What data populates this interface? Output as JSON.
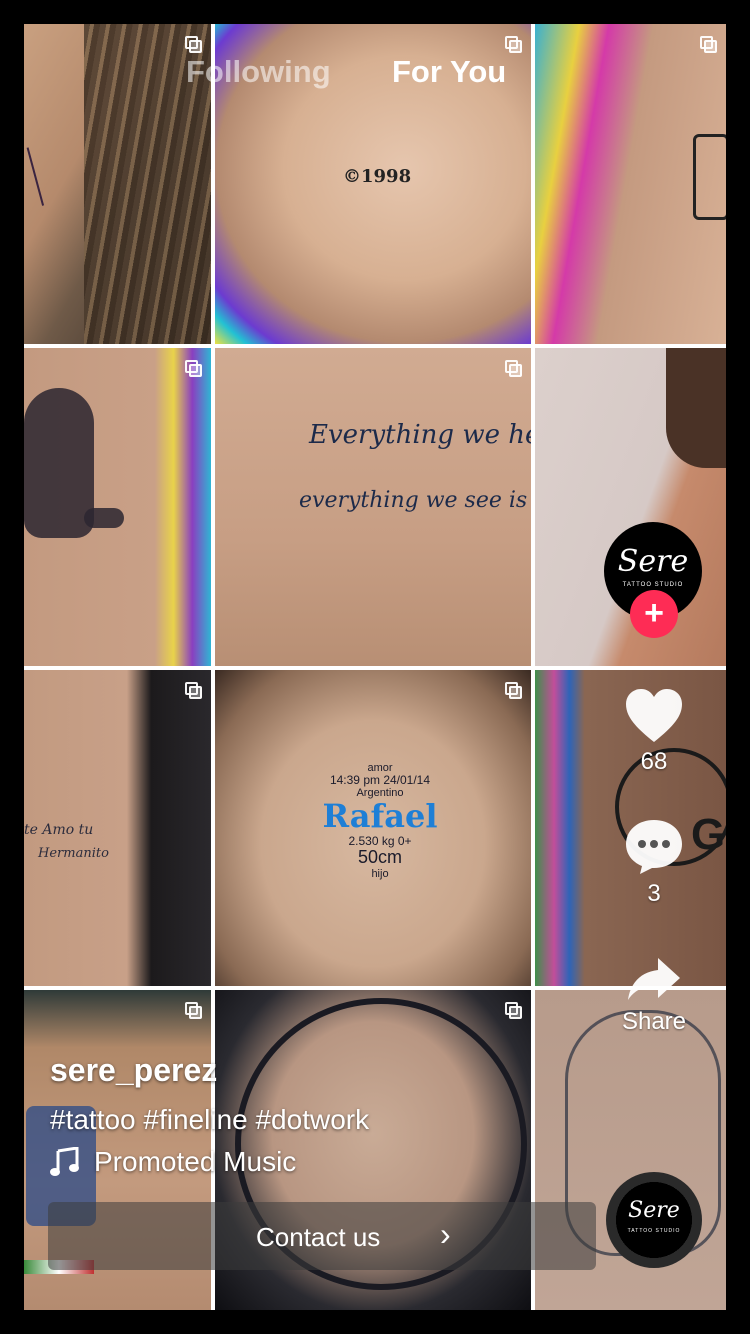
{
  "top_nav": {
    "following": "Following",
    "for_you": "For You"
  },
  "tiles": [
    {
      "caption": ""
    },
    {
      "caption": "©1998"
    },
    {
      "caption": ""
    },
    {
      "caption": ""
    },
    {
      "caption_line1": "Everything we hear",
      "caption_line2": "everything we see is a"
    },
    {
      "caption": ""
    },
    {
      "caption_line1": "te Amo tu",
      "caption_line2": "Hermanito"
    },
    {
      "lines": [
        "amor",
        "14:39 pm 24/01/14",
        "Argentino",
        "Rafael",
        "2.530 kg   0+",
        "50cm",
        "hijo"
      ]
    },
    {
      "caption": "G"
    },
    {
      "caption": ""
    },
    {
      "caption": ""
    },
    {
      "caption": ""
    }
  ],
  "profile": {
    "logo_text": "Sere",
    "logo_sub": "TATTOO STUDIO",
    "follow_symbol": "+"
  },
  "actions": {
    "likes": "68",
    "comments": "3",
    "share_label": "Share"
  },
  "post": {
    "username": "sere_perez",
    "hashtags": "#tattoo #fineline #dotwork",
    "music": "Promoted Music",
    "cta_label": "Contact us",
    "cta_arrow": "›"
  },
  "music_disc": {
    "logo_text": "Sere",
    "logo_sub": "TATTOO STUDIO"
  },
  "colors": {
    "follow_red": "#fe2c55",
    "accent_blue": "#1e7fd6"
  }
}
